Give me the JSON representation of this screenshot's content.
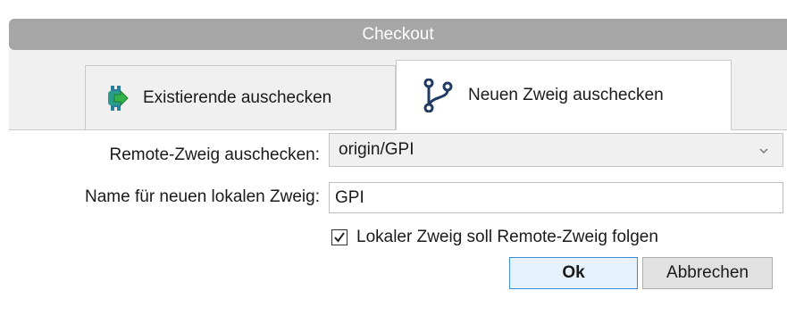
{
  "window": {
    "title": "Checkout"
  },
  "tabs": [
    {
      "label": "Existierende auschecken",
      "icon": "checkout-arrow-icon",
      "selected": false
    },
    {
      "label": "Neuen Zweig auschecken",
      "icon": "branch-icon",
      "selected": true
    }
  ],
  "form": {
    "remote_label": "Remote-Zweig auschecken:",
    "remote_value": "origin/GPI",
    "name_label": "Name für neuen lokalen Zweig:",
    "name_value": "GPI",
    "track_label": "Lokaler Zweig soll Remote-Zweig folgen",
    "track_checked": true
  },
  "buttons": {
    "ok": "Ok",
    "cancel": "Abbrechen"
  },
  "colors": {
    "title_bar": "#a6a6a6",
    "ok_border": "#3c8dd9",
    "icon_teal": "#2b9c8c",
    "icon_green": "#33b24a",
    "branch_navy": "#1f3a63"
  }
}
